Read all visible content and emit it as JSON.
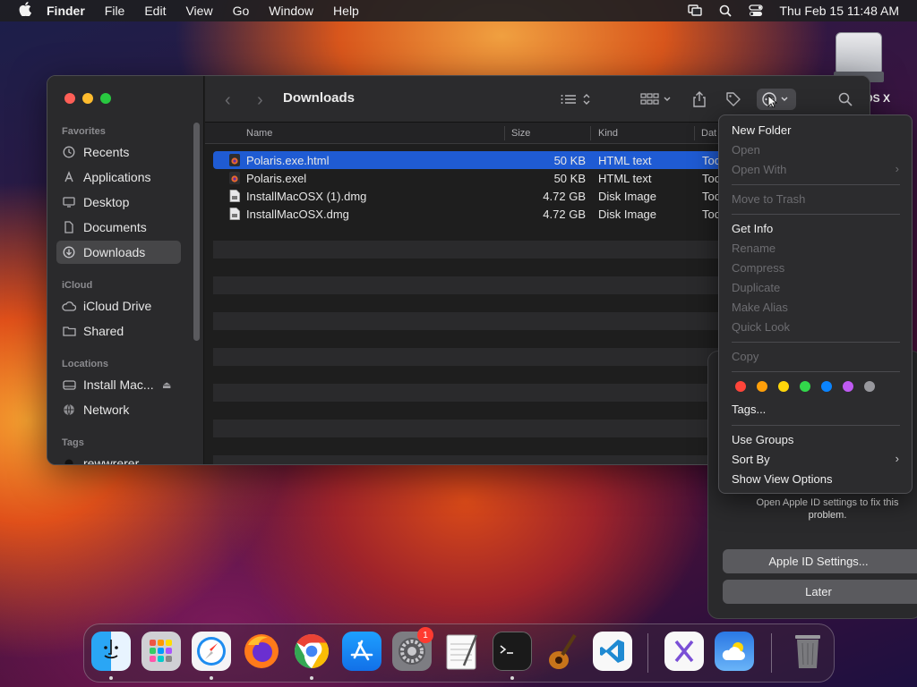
{
  "menubar": {
    "app": "Finder",
    "items": [
      "File",
      "Edit",
      "View",
      "Go",
      "Window",
      "Help"
    ],
    "clock": "Thu Feb 15  11:48 AM"
  },
  "desktop": {
    "disk_label": ": OS X"
  },
  "finder": {
    "title": "Downloads",
    "sidebar": {
      "favorites_header": "Favorites",
      "favorites": [
        "Recents",
        "Applications",
        "Desktop",
        "Documents",
        "Downloads"
      ],
      "icloud_header": "iCloud",
      "icloud": [
        "iCloud Drive",
        "Shared"
      ],
      "locations_header": "Locations",
      "locations": [
        "Install Mac...",
        "Network"
      ],
      "tags_header": "Tags",
      "tags": [
        "rewwrerer"
      ]
    },
    "columns": {
      "name": "Name",
      "size": "Size",
      "kind": "Kind",
      "date": "Dat"
    },
    "files": [
      {
        "name": "Polaris.exe.html",
        "size": "50 KB",
        "kind": "HTML text",
        "date": "Toc"
      },
      {
        "name": "Polaris.exel",
        "size": "50 KB",
        "kind": "HTML text",
        "date": "Toc"
      },
      {
        "name": "InstallMacOSX (1).dmg",
        "size": "4.72 GB",
        "kind": "Disk Image",
        "date": "Toc"
      },
      {
        "name": "InstallMacOSX.dmg",
        "size": "4.72 GB",
        "kind": "Disk Image",
        "date": "Toc"
      }
    ]
  },
  "context_menu": {
    "new_folder": "New Folder",
    "open": "Open",
    "open_with": "Open With",
    "move_to_trash": "Move to Trash",
    "get_info": "Get Info",
    "rename": "Rename",
    "compress": "Compress",
    "duplicate": "Duplicate",
    "make_alias": "Make Alias",
    "quick_look": "Quick Look",
    "copy": "Copy",
    "tags": "Tags...",
    "use_groups": "Use Groups",
    "sort_by": "Sort By",
    "show_view_options": "Show View Options",
    "tag_colors": [
      "#ff453a",
      "#ff9f0a",
      "#ffd60a",
      "#32d74b",
      "#0a84ff",
      "#bf5af2",
      "#98989d"
    ]
  },
  "notification": {
    "message": "Open Apple ID settings to fix this problem.",
    "primary_button": "Apple ID Settings...",
    "secondary_button": "Later"
  },
  "dock": {
    "apps": [
      "finder-icon",
      "launchpad-icon",
      "safari-icon",
      "firefox-icon",
      "chrome-icon",
      "app-store-icon",
      "system-settings-icon",
      "textedit-icon",
      "terminal-icon",
      "garageband-icon",
      "vscode-icon",
      "visual-studio-icon",
      "weather-icon",
      "trash-icon"
    ],
    "settings_badge": "1"
  }
}
